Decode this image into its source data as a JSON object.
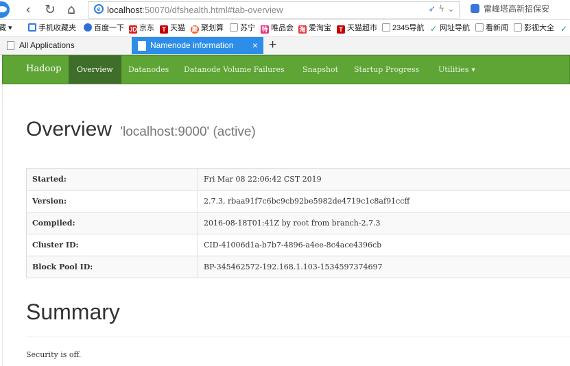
{
  "browser": {
    "nav": {
      "back": "‹",
      "forward": "",
      "reload": "↻",
      "home": "⌂"
    },
    "url_host": "localhost",
    "url_rest": ":50070/dfshealth.html#tab-overview",
    "search_box_text": "雷峰塔高新招保安",
    "bookmarks_menu_label": "藏 ▾",
    "bookmarks": [
      {
        "label": "手机收藏夹",
        "icon": "phone-icon"
      },
      {
        "label": "百度一下",
        "icon": "baidu-paw-icon"
      },
      {
        "label": "京东",
        "icon": "jd-icon",
        "badge": "JD"
      },
      {
        "label": "天猫",
        "icon": "tmall-icon",
        "badge": "T"
      },
      {
        "label": "聚划算",
        "icon": "juhuasuan-icon",
        "badge": "聚"
      },
      {
        "label": "苏宁",
        "icon": "page-icon"
      },
      {
        "label": "唯品会",
        "icon": "vip-icon",
        "badge": "特"
      },
      {
        "label": "爱淘宝",
        "icon": "aitaobao-icon",
        "badge": "淘"
      },
      {
        "label": "天猫超市",
        "icon": "tmall-market-icon",
        "badge": "T"
      },
      {
        "label": "2345导航",
        "icon": "page-icon"
      },
      {
        "label": "网址导航",
        "icon": "check-icon",
        "badge": "✓"
      },
      {
        "label": "看新闻",
        "icon": "page-icon"
      },
      {
        "label": "影视大全",
        "icon": "page-icon"
      },
      {
        "label": "",
        "icon": "check-icon",
        "badge": "✓"
      }
    ],
    "tabs": [
      {
        "label": "All Applications",
        "active": false
      },
      {
        "label": "Namenode information",
        "active": true
      }
    ],
    "tab_close": "×",
    "new_tab": "+"
  },
  "navbar": {
    "brand": "Hadoop",
    "items": [
      {
        "label": "Overview",
        "active": true
      },
      {
        "label": "Datanodes",
        "active": false
      },
      {
        "label": "Datanode Volume Failures",
        "active": false
      },
      {
        "label": "Snapshot",
        "active": false
      },
      {
        "label": "Startup Progress",
        "active": false
      },
      {
        "label": "Utilities",
        "active": false,
        "dropdown": true
      }
    ]
  },
  "overview": {
    "title": "Overview",
    "subtitle": "'localhost:9000' (active)",
    "rows": [
      {
        "key": "Started:",
        "value": "Fri Mar 08 22:06:42 CST 2019"
      },
      {
        "key": "Version:",
        "value": "2.7.3, rbaa91f7c6bc9cb92be5982de4719c1c8af91ccff"
      },
      {
        "key": "Compiled:",
        "value": "2016-08-18T01:41Z by root from branch-2.7.3"
      },
      {
        "key": "Cluster ID:",
        "value": "CID-41006d1a-b7b7-4896-a4ee-8c4ace4396cb"
      },
      {
        "key": "Block Pool ID:",
        "value": "BP-345462572-192.168.1.103-1534597374697"
      }
    ]
  },
  "summary": {
    "title": "Summary",
    "security": "Security is off."
  },
  "colors": {
    "navbar": "#5ea536",
    "navbar_active": "#3f6e2a",
    "tab_active": "#2e8de8"
  }
}
